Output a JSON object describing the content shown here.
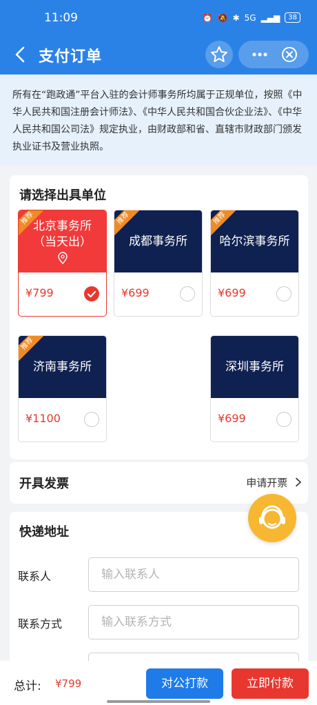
{
  "status_bar": {
    "time": "11:09",
    "network": "5G",
    "battery": "38"
  },
  "nav": {
    "title": "支付订单"
  },
  "notice": {
    "text": "所有在“跑政通”平台入驻的会计师事务所均属于正规单位，按照《中华人民共和国注册会计师法》、《中华人民共和国合伙企业法》、《中华人民共和国公司法》规定执业，由财政部和省、直辖市财政部门颁发执业证书及营业执照。"
  },
  "unit_section": {
    "title": "请选择出具单位",
    "units": [
      {
        "name": "北京事务所",
        "sub": "（当天出）",
        "price": "¥799",
        "tag": "推荐",
        "selected": true
      },
      {
        "name": "成都事务所",
        "sub": "",
        "price": "¥699",
        "tag": "推荐",
        "selected": false
      },
      {
        "name": "哈尔滨事务所",
        "sub": "",
        "price": "¥699",
        "tag": "推荐",
        "selected": false
      },
      {
        "name": "济南事务所",
        "sub": "",
        "price": "¥1100",
        "tag": "推荐",
        "selected": false
      },
      {
        "name": "深圳事务所",
        "sub": "",
        "price": "¥699",
        "tag": "",
        "selected": false
      }
    ]
  },
  "invoice": {
    "title": "开具发票",
    "link": "申请开票"
  },
  "address": {
    "title": "快递地址",
    "contact_label": "联系人",
    "contact_placeholder": "输入联系人",
    "phone_label": "联系方式",
    "phone_placeholder": "输入联系方式"
  },
  "bottom": {
    "total_label": "总计:",
    "total_value": "¥799",
    "corporate_button": "对公打款",
    "pay_button": "立即付款"
  },
  "colors": {
    "brand_blue": "#2b82e6",
    "price_red": "#e8372f",
    "card_navy": "#0f2150",
    "tag_orange": "#f08a24"
  }
}
